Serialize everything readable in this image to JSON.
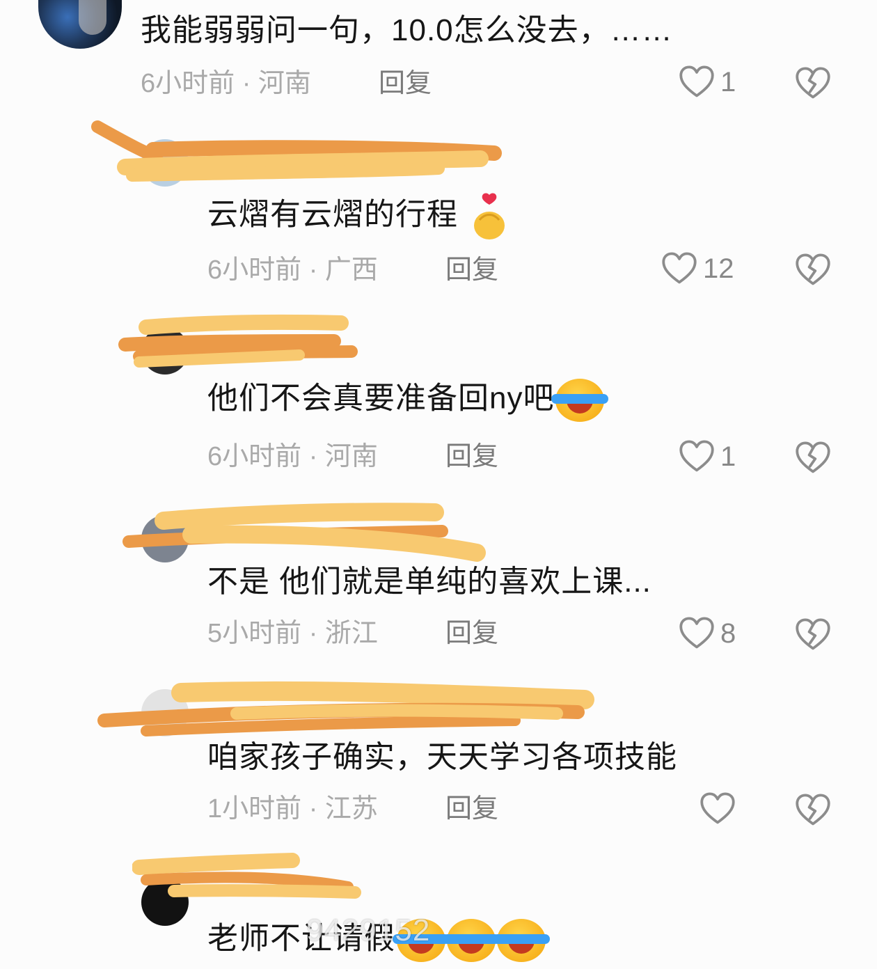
{
  "comments": [
    {
      "text": "我能弱弱问一句，10.0怎么没去，……",
      "time": "6小时前",
      "location": "河南",
      "reply_label": "回复",
      "likes": "1"
    },
    {
      "text": "云熠有云熠的行程",
      "emoji": "finger-heart-emoji",
      "time": "6小时前",
      "location": "广西",
      "reply_label": "回复",
      "likes": "12"
    },
    {
      "text": "他们不会真要准备回ny吧",
      "emoji": "laughing-crying-emoji",
      "time": "6小时前",
      "location": "河南",
      "reply_label": "回复",
      "likes": "1"
    },
    {
      "text": "不是 他们就是单纯的喜欢上课...",
      "time": "5小时前",
      "location": "浙江",
      "reply_label": "回复",
      "likes": "8"
    },
    {
      "text": "咱家孩子确实，天天学习各项技能",
      "time": "1小时前",
      "location": "江苏",
      "reply_label": "回复",
      "likes": ""
    },
    {
      "text": "老师不让请假",
      "emoji": "laughing-crying-emoji x3"
    }
  ],
  "watermark": "9429152",
  "icons": {
    "like": "heart-outline-icon",
    "dislike": "broken-heart-icon"
  },
  "colors": {
    "background": "#fcfcfc",
    "text": "#161616",
    "meta": "#a9a9a9",
    "icon": "#888888",
    "redaction_orange": "#eb9a48",
    "redaction_yellow": "#f8c970"
  }
}
